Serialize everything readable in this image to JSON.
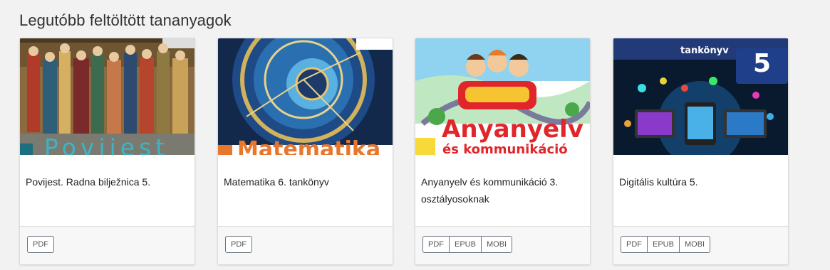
{
  "section": {
    "title": "Legutóbb feltöltött tananyagok"
  },
  "cards": [
    {
      "title": "Povijest. Radna bilježnica 5.",
      "cover_text": "Povijest",
      "formats": [
        "PDF"
      ]
    },
    {
      "title": "Matematika 6. tankönyv",
      "cover_text": "Matematika",
      "formats": [
        "PDF"
      ]
    },
    {
      "title": "Anyanyelv és kommunikáció 3. osztályosoknak",
      "cover_text": "Anyanyelv",
      "cover_subtext": "és kommunikáció",
      "formats": [
        "PDF",
        "EPUB",
        "MOBI"
      ]
    },
    {
      "title": "Digitális kultúra 5.",
      "cover_text": "tankönyv",
      "cover_badge": "5",
      "formats": [
        "PDF",
        "EPUB",
        "MOBI"
      ]
    }
  ],
  "colors": {
    "page_bg": "#f2f2f2",
    "card_border": "#dcdcdc",
    "button_border": "#6c757d",
    "povijest_teal": "#3fb3c4",
    "matematika_orange": "#e8772e",
    "anyanyelv_red": "#e0252b",
    "digitalis_blue": "#1f3f8a"
  }
}
